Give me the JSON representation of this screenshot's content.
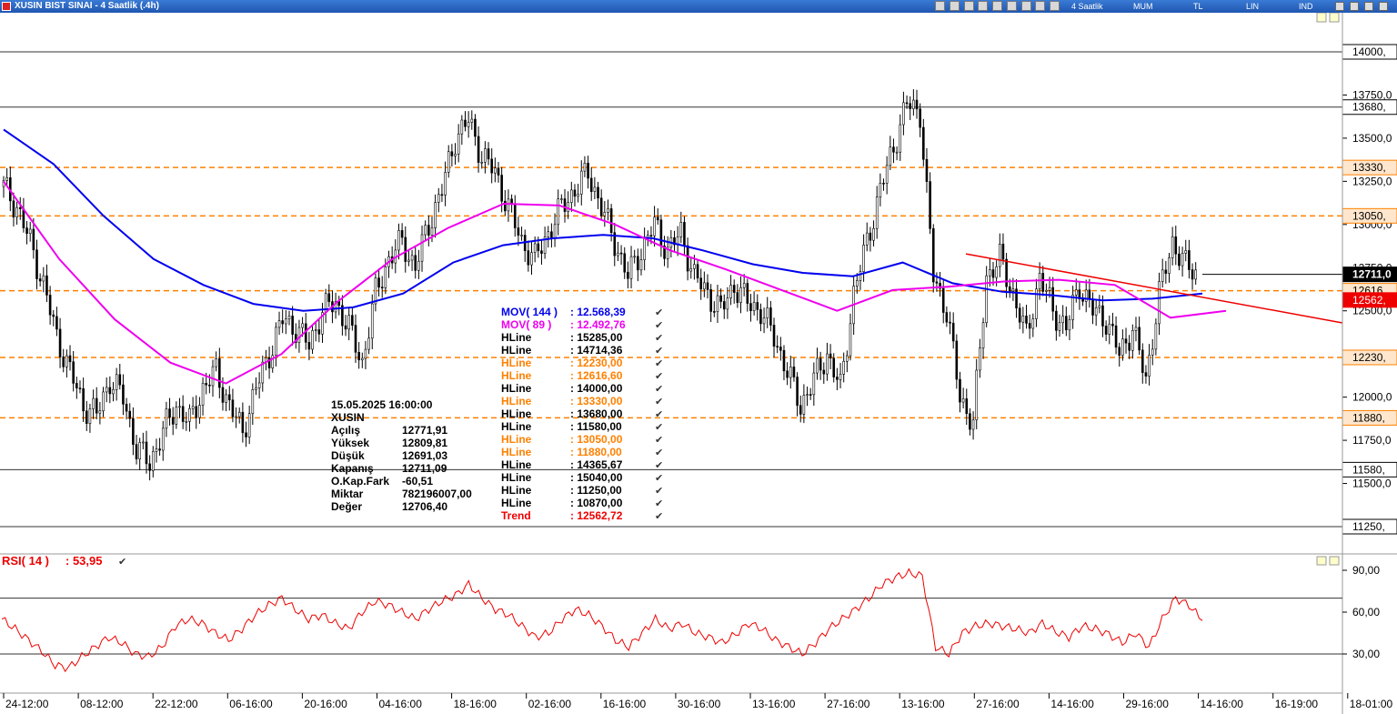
{
  "window": {
    "title": "XUSIN BIST SINAI - 4 Saatlik (.4h)",
    "period": "4 Saatlik",
    "modes": [
      "MUM",
      "TL",
      "LIN",
      "IND"
    ]
  },
  "colors": {
    "mov144": "#0000ee",
    "mov89": "#ee00ee",
    "hline_solid": "#333333",
    "hline_dashed": "#ff8000",
    "trend": "#ee0000",
    "rsi": "#ee0000",
    "candle": "#000000"
  },
  "chart_data": {
    "type": "candlestick",
    "price_axis": {
      "ticks": [
        "14000,",
        "13750,0",
        "13680,",
        "13500,0",
        "13330,",
        "13250,0",
        "13050,",
        "13000,0",
        "12750,0",
        "12711,0",
        "12616,",
        "12562,",
        "12500,0",
        "12230,",
        "12000,0",
        "11880,",
        "11750,0",
        "11580,",
        "11500,0",
        "11250,"
      ]
    },
    "time_axis": {
      "ticks": [
        "24-12:00",
        "08-12:00",
        "22-12:00",
        "06-16:00",
        "20-16:00",
        "04-16:00",
        "18-16:00",
        "02-16:00",
        "16-16:00",
        "30-16:00",
        "13-16:00",
        "27-16:00",
        "13-16:00",
        "27-16:00",
        "14-16:00",
        "29-16:00",
        "14-16:00",
        "16-19:00",
        "18-01:00"
      ]
    },
    "info": {
      "datetime": "15.05.2025  16:00:00",
      "symbol": "XUSIN",
      "rows": [
        {
          "label": "Açılış",
          "value": "12771,91"
        },
        {
          "label": "Yüksek",
          "value": "12809,81"
        },
        {
          "label": "Düşük",
          "value": "12691,03"
        },
        {
          "label": "Kapanış",
          "value": "12711,09"
        },
        {
          "label": "O.Kap.Fark",
          "value": "-60,51"
        },
        {
          "label": "Miktar",
          "value": "782196007,00"
        },
        {
          "label": "Değer",
          "value": "12706,40"
        }
      ]
    },
    "legend": [
      {
        "label": "MOV( 144 )",
        "value": ": 12.568,39",
        "color": "#0000ee"
      },
      {
        "label": "MOV( 89 )",
        "value": ": 12.492,76",
        "color": "#ee00ee"
      },
      {
        "label": "HLine",
        "value": ": 15285,00",
        "color": "#000000"
      },
      {
        "label": "HLine",
        "value": ": 14714,36",
        "color": "#000000"
      },
      {
        "label": "HLine",
        "value": ": 12230,00",
        "color": "#ff8000"
      },
      {
        "label": "HLine",
        "value": ": 12616,60",
        "color": "#ff8000"
      },
      {
        "label": "HLine",
        "value": ": 14000,00",
        "color": "#000000"
      },
      {
        "label": "HLine",
        "value": ": 13330,00",
        "color": "#ff8000"
      },
      {
        "label": "HLine",
        "value": ": 13680,00",
        "color": "#000000"
      },
      {
        "label": "HLine",
        "value": ": 11580,00",
        "color": "#000000"
      },
      {
        "label": "HLine",
        "value": ": 13050,00",
        "color": "#ff8000"
      },
      {
        "label": "HLine",
        "value": ": 11880,00",
        "color": "#ff8000"
      },
      {
        "label": "HLine",
        "value": ": 14365,67",
        "color": "#000000"
      },
      {
        "label": "HLine",
        "value": ": 15040,00",
        "color": "#000000"
      },
      {
        "label": "HLine",
        "value": ": 11250,00",
        "color": "#000000"
      },
      {
        "label": "HLine",
        "value": ": 10870,00",
        "color": "#000000"
      },
      {
        "label": "Trend",
        "value": ": 12562,72",
        "color": "#ee0000"
      }
    ],
    "hlines": [
      {
        "value": 14000,
        "style": "solid",
        "label": "14000,"
      },
      {
        "value": 13680,
        "style": "solid",
        "label": "13680,"
      },
      {
        "value": 13330,
        "style": "dashed",
        "label": "13330,"
      },
      {
        "value": 13050,
        "style": "dashed",
        "label": "13050,"
      },
      {
        "value": 12616.6,
        "style": "dashed",
        "label": "12616,"
      },
      {
        "value": 12230,
        "style": "dashed",
        "label": "12230,"
      },
      {
        "value": 11880,
        "style": "dashed",
        "label": "11880,"
      },
      {
        "value": 11580,
        "style": "solid",
        "label": "11580,"
      },
      {
        "value": 11250,
        "style": "solid",
        "label": "11250,"
      }
    ],
    "last_price": {
      "value": 12711.09,
      "label": "12711,0"
    },
    "trend_value": {
      "value": 12562.72,
      "label": "12562,"
    },
    "trendline": [
      {
        "value": 12830
      },
      {
        "value": 12430
      }
    ],
    "price_series": [
      13220,
      13100,
      12900,
      12650,
      12350,
      12150,
      11950,
      11900,
      12100,
      12000,
      11700,
      11620,
      11800,
      11950,
      11850,
      12050,
      12150,
      11950,
      11800,
      12050,
      12250,
      12450,
      12400,
      12300,
      12500,
      12550,
      12400,
      12200,
      12600,
      12800,
      12900,
      12750,
      13000,
      13200,
      13500,
      13600,
      13400,
      13300,
      13100,
      12900,
      12800,
      12950,
      13100,
      13200,
      13300,
      13100,
      12900,
      12700,
      12850,
      13000,
      12850,
      12950,
      12700,
      12600,
      12500,
      12650,
      12550,
      12500,
      12350,
      12150,
      11950,
      12100,
      12250,
      12050,
      12600,
      12900,
      13200,
      13450,
      13700,
      13650,
      12700,
      12500,
      12000,
      11850,
      12700,
      12800,
      12600,
      12350,
      12700,
      12500,
      12400,
      12650,
      12500,
      12450,
      12250,
      12400,
      12100,
      12600,
      12900,
      12760,
      12711
    ],
    "mov144": [
      13550,
      13350,
      13050,
      12800,
      12650,
      12540,
      12500,
      12520,
      12600,
      12780,
      12880,
      12920,
      12940,
      12920,
      12850,
      12770,
      12720,
      12700,
      12780,
      12660,
      12610,
      12590,
      12560,
      12570,
      12600
    ],
    "mov89": [
      13250,
      12800,
      12450,
      12200,
      12080,
      12250,
      12550,
      12800,
      12980,
      13120,
      13110,
      13000,
      12850,
      12740,
      12620,
      12500,
      12620,
      12640,
      12670,
      12680,
      12650,
      12460,
      12500
    ],
    "rsi": {
      "label": "RSI( 14 )",
      "value_text": ": 53,95",
      "ticks": [
        "90,00",
        "60,00",
        "30,00"
      ],
      "levels": [
        70,
        30
      ],
      "series": [
        55,
        48,
        40,
        32,
        22,
        20,
        28,
        35,
        42,
        38,
        30,
        28,
        35,
        50,
        55,
        52,
        45,
        40,
        48,
        58,
        65,
        70,
        62,
        55,
        58,
        52,
        48,
        60,
        68,
        65,
        60,
        55,
        62,
        68,
        72,
        80,
        70,
        62,
        58,
        50,
        42,
        45,
        55,
        62,
        58,
        50,
        40,
        35,
        45,
        55,
        48,
        52,
        45,
        42,
        38,
        44,
        52,
        48,
        40,
        35,
        30,
        38,
        48,
        55,
        62,
        70,
        80,
        85,
        88,
        86,
        35,
        30,
        45,
        50,
        52,
        50,
        48,
        45,
        52,
        46,
        42,
        50,
        48,
        44,
        38,
        45,
        35,
        55,
        70,
        65,
        53.95
      ]
    }
  }
}
